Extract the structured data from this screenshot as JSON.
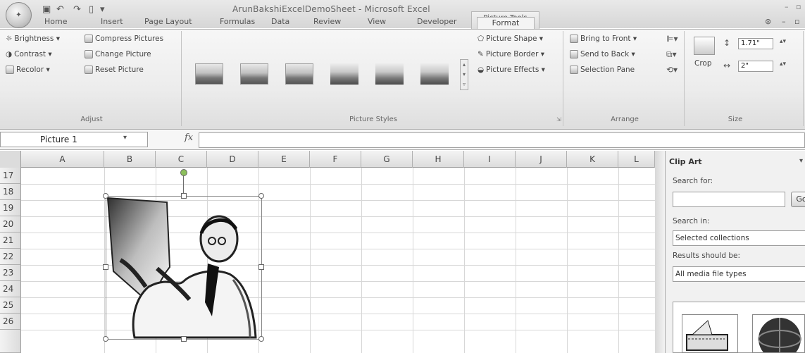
{
  "window": {
    "title": "ArunBakshiExcelDemoSheet - Microsoft Excel",
    "context_group": "Picture Tools"
  },
  "tabs": [
    "Home",
    "Insert",
    "Page Layout",
    "Formulas",
    "Data",
    "Review",
    "View",
    "Developer",
    "Format"
  ],
  "ribbon": {
    "adjust": {
      "label": "Adjust",
      "brightness": "Brightness ▾",
      "contrast": "Contrast ▾",
      "recolor": "Recolor ▾",
      "compress": "Compress Pictures",
      "change": "Change Picture",
      "reset": "Reset Picture"
    },
    "styles": {
      "label": "Picture Styles",
      "shape": "Picture Shape ▾",
      "border": "Picture Border ▾",
      "effects": "Picture Effects ▾"
    },
    "arrange": {
      "label": "Arrange",
      "front": "Bring to Front ▾",
      "back": "Send to Back ▾",
      "pane": "Selection Pane"
    },
    "size": {
      "label": "Size",
      "crop": "Crop",
      "height": "1.71\"",
      "width": "2\""
    }
  },
  "formula_bar": {
    "name_box": "Picture 1",
    "fx": "fx"
  },
  "columns": [
    "A",
    "B",
    "C",
    "D",
    "E",
    "F",
    "G",
    "H",
    "I",
    "J",
    "K",
    "L"
  ],
  "rows": [
    "17",
    "18",
    "19",
    "20",
    "21",
    "22",
    "23",
    "24",
    "25",
    "26"
  ],
  "pane": {
    "title": "Clip Art",
    "search_for": "Search for:",
    "go": "Go",
    "search_in": "Search in:",
    "search_in_value": "Selected collections",
    "results": "Results should be:",
    "results_value": "All media file types"
  }
}
